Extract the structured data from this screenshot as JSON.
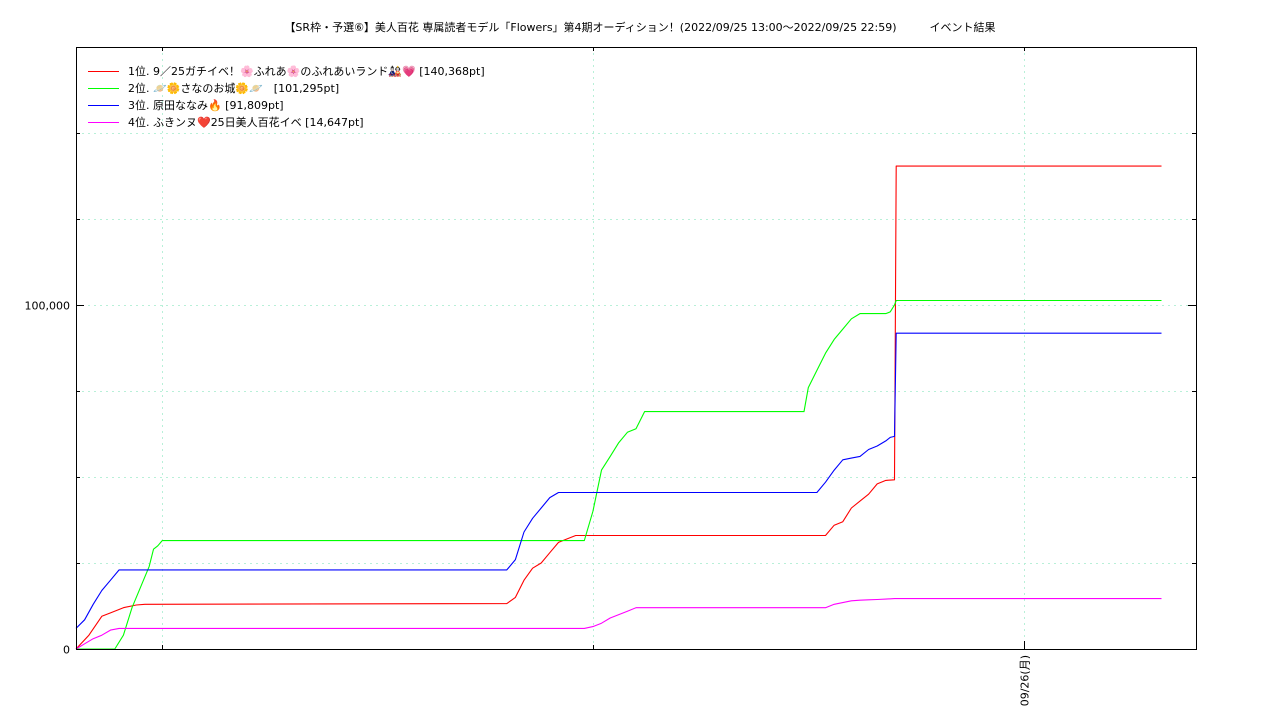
{
  "chart_data": {
    "type": "line",
    "title": "【SR枠・予選⑥】美人百花 専属読者モデル「Flowers」第4期オーディション！(2022/09/25 13:00～2022/09/25 22:59)　　　イベント結果",
    "xlabel": "",
    "ylabel": "",
    "x_unit": "hours since 2022/09/25 13:00",
    "xlim": [
      0,
      13
    ],
    "ylim": [
      0,
      175000
    ],
    "y_ticks": [
      0,
      100000
    ],
    "y_tick_labels": [
      "0",
      "100,000"
    ],
    "x_ticks": [
      11.0
    ],
    "x_tick_labels": [
      "09/26(月)"
    ],
    "grid": true,
    "legend_position": "top-left",
    "series": [
      {
        "name": "1位. 9／25ガチイベ！🌸ふれあ🌸のふれあいランド🎎💗 [140,368pt]",
        "color": "#ff0000",
        "x": [
          0.0,
          0.15,
          0.3,
          0.4,
          0.55,
          0.7,
          0.8,
          5.0,
          5.1,
          5.2,
          5.3,
          5.4,
          5.5,
          5.6,
          5.7,
          5.8,
          8.7,
          8.8,
          8.9,
          9.0,
          9.1,
          9.2,
          9.3,
          9.4,
          9.5,
          9.52,
          12.6
        ],
        "y": [
          0,
          4000,
          9500,
          10500,
          12000,
          12800,
          13000,
          13200,
          15000,
          20000,
          23500,
          25000,
          28000,
          31000,
          32000,
          33000,
          33000,
          36000,
          37000,
          41000,
          43000,
          45000,
          48000,
          49000,
          49200,
          140368,
          140368
        ]
      },
      {
        "name": "2位. 🪐🌼さなのお城🌼🪐　[101,295pt]",
        "color": "#00ff00",
        "x": [
          0.0,
          0.45,
          0.55,
          0.65,
          0.75,
          0.85,
          0.9,
          0.95,
          1.0,
          5.0,
          5.9,
          6.0,
          6.1,
          6.2,
          6.3,
          6.4,
          6.5,
          6.6,
          6.7,
          8.45,
          8.5,
          8.6,
          8.7,
          8.8,
          8.9,
          9.0,
          9.1,
          9.2,
          9.3,
          9.4,
          9.45,
          9.5,
          9.52,
          12.6
        ],
        "y": [
          0,
          0,
          4000,
          12000,
          18000,
          24000,
          29000,
          30000,
          31500,
          31500,
          31500,
          40000,
          52000,
          56000,
          60000,
          63000,
          64000,
          69000,
          69000,
          69000,
          76000,
          81000,
          86000,
          90000,
          93000,
          96000,
          97500,
          97500,
          97500,
          97500,
          98000,
          100000,
          101295,
          101295
        ]
      },
      {
        "name": "3位. 原田ななみ🔥 [91,809pt]",
        "color": "#0000ff",
        "x": [
          0.0,
          0.1,
          0.2,
          0.3,
          0.4,
          0.5,
          5.0,
          5.1,
          5.2,
          5.3,
          5.4,
          5.5,
          5.6,
          5.7,
          8.6,
          8.7,
          8.8,
          8.9,
          9.0,
          9.1,
          9.2,
          9.3,
          9.4,
          9.45,
          9.5,
          9.52,
          12.6
        ],
        "y": [
          6000,
          8500,
          13000,
          17000,
          20000,
          23000,
          23000,
          26000,
          34000,
          38000,
          41000,
          44000,
          45500,
          45500,
          45500,
          48500,
          52000,
          55000,
          55500,
          56000,
          58000,
          59000,
          60500,
          61500,
          61800,
          91809,
          91809
        ]
      },
      {
        "name": "4位. ふきンヌ❤️25日美人百花イベ [14,647pt]",
        "color": "#ff00ff",
        "x": [
          0.0,
          0.1,
          0.2,
          0.3,
          0.4,
          0.5,
          5.9,
          6.0,
          6.1,
          6.2,
          6.3,
          6.4,
          6.5,
          6.6,
          8.7,
          8.8,
          8.9,
          9.0,
          9.1,
          9.2,
          9.3,
          9.4,
          9.5,
          12.6
        ],
        "y": [
          0,
          1500,
          3000,
          4000,
          5500,
          6000,
          6000,
          6500,
          7500,
          9000,
          10000,
          11000,
          12000,
          12000,
          12000,
          13000,
          13500,
          14000,
          14200,
          14300,
          14400,
          14500,
          14647,
          14647
        ]
      }
    ]
  }
}
